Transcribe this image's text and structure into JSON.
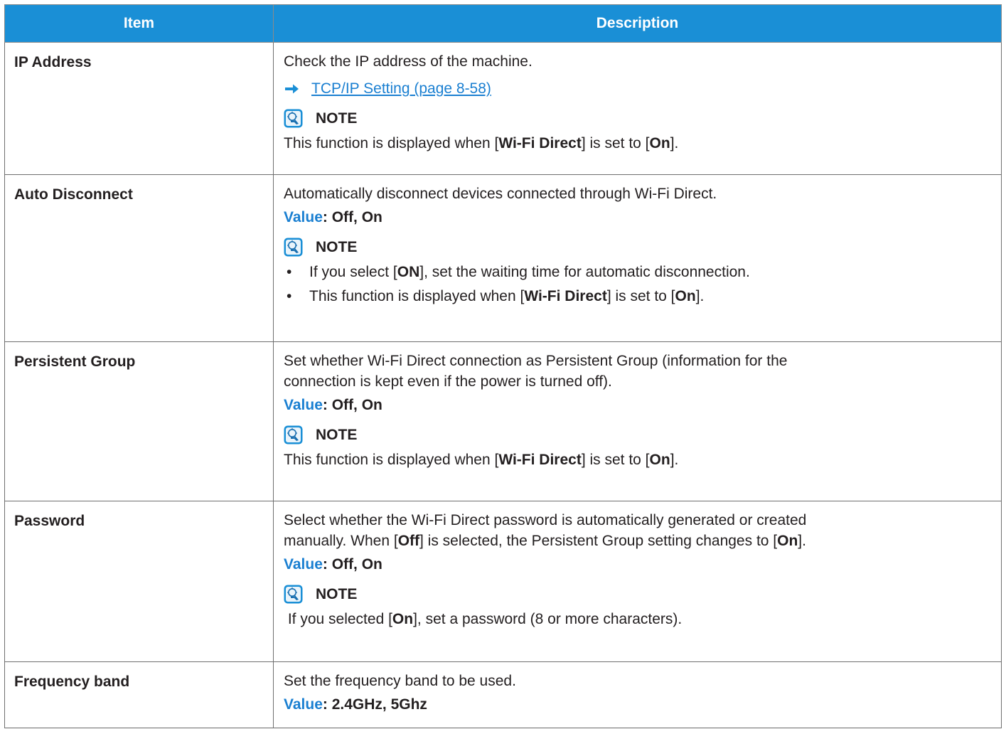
{
  "table": {
    "header_item": "Item",
    "header_description": "Description"
  },
  "icons": {
    "arrow": "right-arrow-icon",
    "note": "lightbulb-note-icon",
    "accent_color": "#1a8fd6"
  },
  "rows": {
    "ip_address": {
      "item": "IP Address",
      "description": "Check the IP address of the machine.",
      "link": "TCP/IP Setting (page 8-58)",
      "note_title": "NOTE",
      "note_pre": "This function is displayed when [",
      "note_b1": "Wi-Fi Direct",
      "note_mid": "] is set to [",
      "note_b2": "On",
      "note_post": "]."
    },
    "auto_disconnect": {
      "item": "Auto Disconnect",
      "description": "Automatically disconnect devices connected through Wi-Fi Direct.",
      "value_label": "Value",
      "value_text": ": Off, On",
      "note_title": "NOTE",
      "bullet_char": "•",
      "bullet1_pre": "If you select [",
      "bullet1_b": "ON",
      "bullet1_post": "], set the waiting time for automatic disconnection.",
      "bullet2_pre": "This function is displayed when [",
      "bullet2_b1": "Wi-Fi Direct",
      "bullet2_mid": "] is set to [",
      "bullet2_b2": "On",
      "bullet2_post": "]."
    },
    "persistent_group": {
      "item": "Persistent Group",
      "description_line1": "Set whether Wi-Fi Direct connection as Persistent Group (information for the",
      "description_line2": "connection is kept even if the power is turned off).",
      "value_label": "Value",
      "value_text": ": Off, On",
      "note_title": "NOTE",
      "note_pre": "This function is displayed when [",
      "note_b1": "Wi-Fi Direct",
      "note_mid": "] is set to [",
      "note_b2": "On",
      "note_post": "]."
    },
    "password": {
      "item": "Password",
      "description_line1": "Select whether the Wi-Fi Direct password is automatically generated or created",
      "description_line2_pre": "manually. When [",
      "description_line2_b1": "Off",
      "description_line2_mid": "] is selected, the Persistent Group setting changes to [",
      "description_line2_b2": "On",
      "description_line2_post": "].",
      "value_label": "Value",
      "value_text": ": Off, On",
      "note_title": "NOTE",
      "note_pre": " If you selected [",
      "note_b": "On",
      "note_post": "], set a password (8 or more characters)."
    },
    "frequency_band": {
      "item": "Frequency band",
      "description": "Set the frequency band to be used.",
      "value_label": "Value",
      "value_text": ": 2.4GHz, 5Ghz"
    }
  }
}
